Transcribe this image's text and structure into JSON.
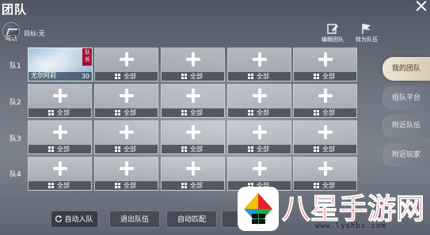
{
  "header": {
    "title": "团队"
  },
  "target": {
    "shout_label": "喊话",
    "label": "目标:无"
  },
  "top_actions": {
    "edit_team": "编辑团队",
    "to_team": "转为队伍"
  },
  "rows": [
    {
      "label": "队1"
    },
    {
      "label": "队2"
    },
    {
      "label": "队3"
    },
    {
      "label": "队4"
    }
  ],
  "member": {
    "name": "尤尔阿莉",
    "level": "30",
    "badge": "队长"
  },
  "slot_label": "全部",
  "side_tabs": [
    {
      "label": "我的团队",
      "active": true
    },
    {
      "label": "组队平台",
      "active": false
    },
    {
      "label": "附近队伍",
      "active": false
    },
    {
      "label": "附近玩家",
      "active": false
    }
  ],
  "bottom": {
    "auto_join": "自动入队",
    "leave": "退出队伍",
    "auto_match": "自动匹配"
  },
  "watermark": {
    "text": "八星手游网",
    "url": "www.lyshbx.com"
  },
  "colors": {
    "captain": "#a3123a",
    "watermark_red": "#e8202e",
    "active_tab": "#efe6d3"
  }
}
